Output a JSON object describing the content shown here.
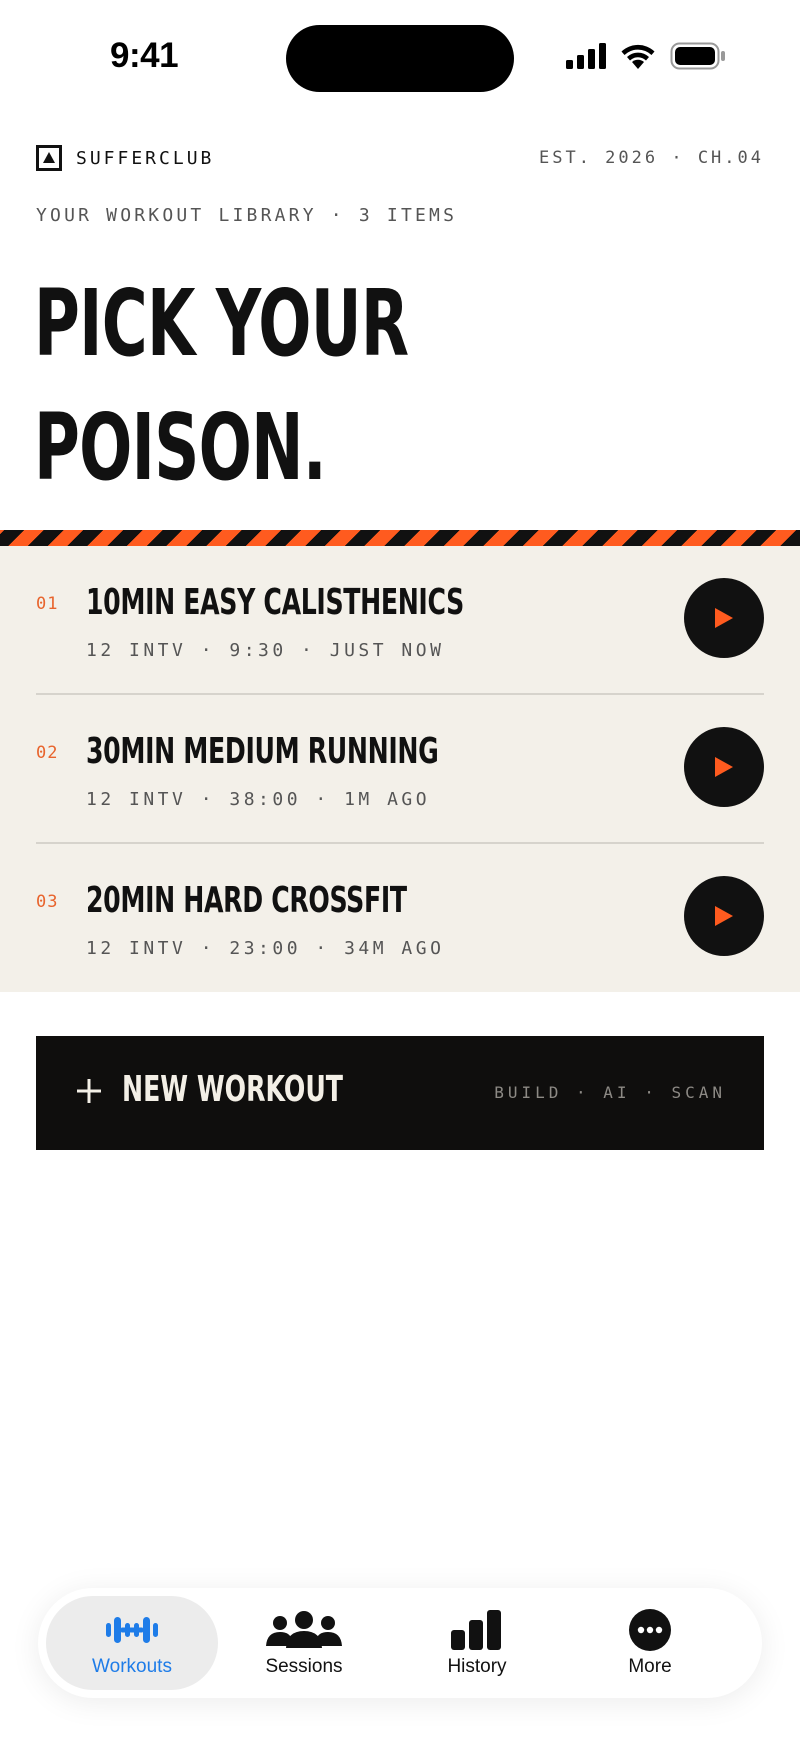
{
  "status_bar": {
    "time": "9:41"
  },
  "header": {
    "brand": "SUFFERCLUB",
    "est": "EST. 2026 · CH.04",
    "subtitle": "YOUR WORKOUT LIBRARY · 3 ITEMS",
    "headline_line1": "PICK YOUR",
    "headline_line2": "POISON."
  },
  "workouts": [
    {
      "num": "01",
      "title": "10MIN EASY CALISTHENICS",
      "meta": "12 INTV · 9:30 · JUST NOW"
    },
    {
      "num": "02",
      "title": "30MIN MEDIUM RUNNING",
      "meta": "12 INTV · 38:00 · 1M AGO"
    },
    {
      "num": "03",
      "title": "20MIN HARD CROSSFIT",
      "meta": "12 INTV · 23:00 · 34M AGO"
    }
  ],
  "new_workout": {
    "label": "NEW WORKOUT",
    "options": "BUILD · AI · SCAN"
  },
  "tabs": [
    {
      "label": "Workouts",
      "icon": "dumbbell-icon",
      "active": true
    },
    {
      "label": "Sessions",
      "icon": "people-icon",
      "active": false
    },
    {
      "label": "History",
      "icon": "bar-chart-icon",
      "active": false
    },
    {
      "label": "More",
      "icon": "more-icon",
      "active": false
    }
  ],
  "colors": {
    "accent": "#ff5b1f",
    "ink": "#111111",
    "panel": "#f3f0e9",
    "tab_active": "#1e7ce8"
  }
}
